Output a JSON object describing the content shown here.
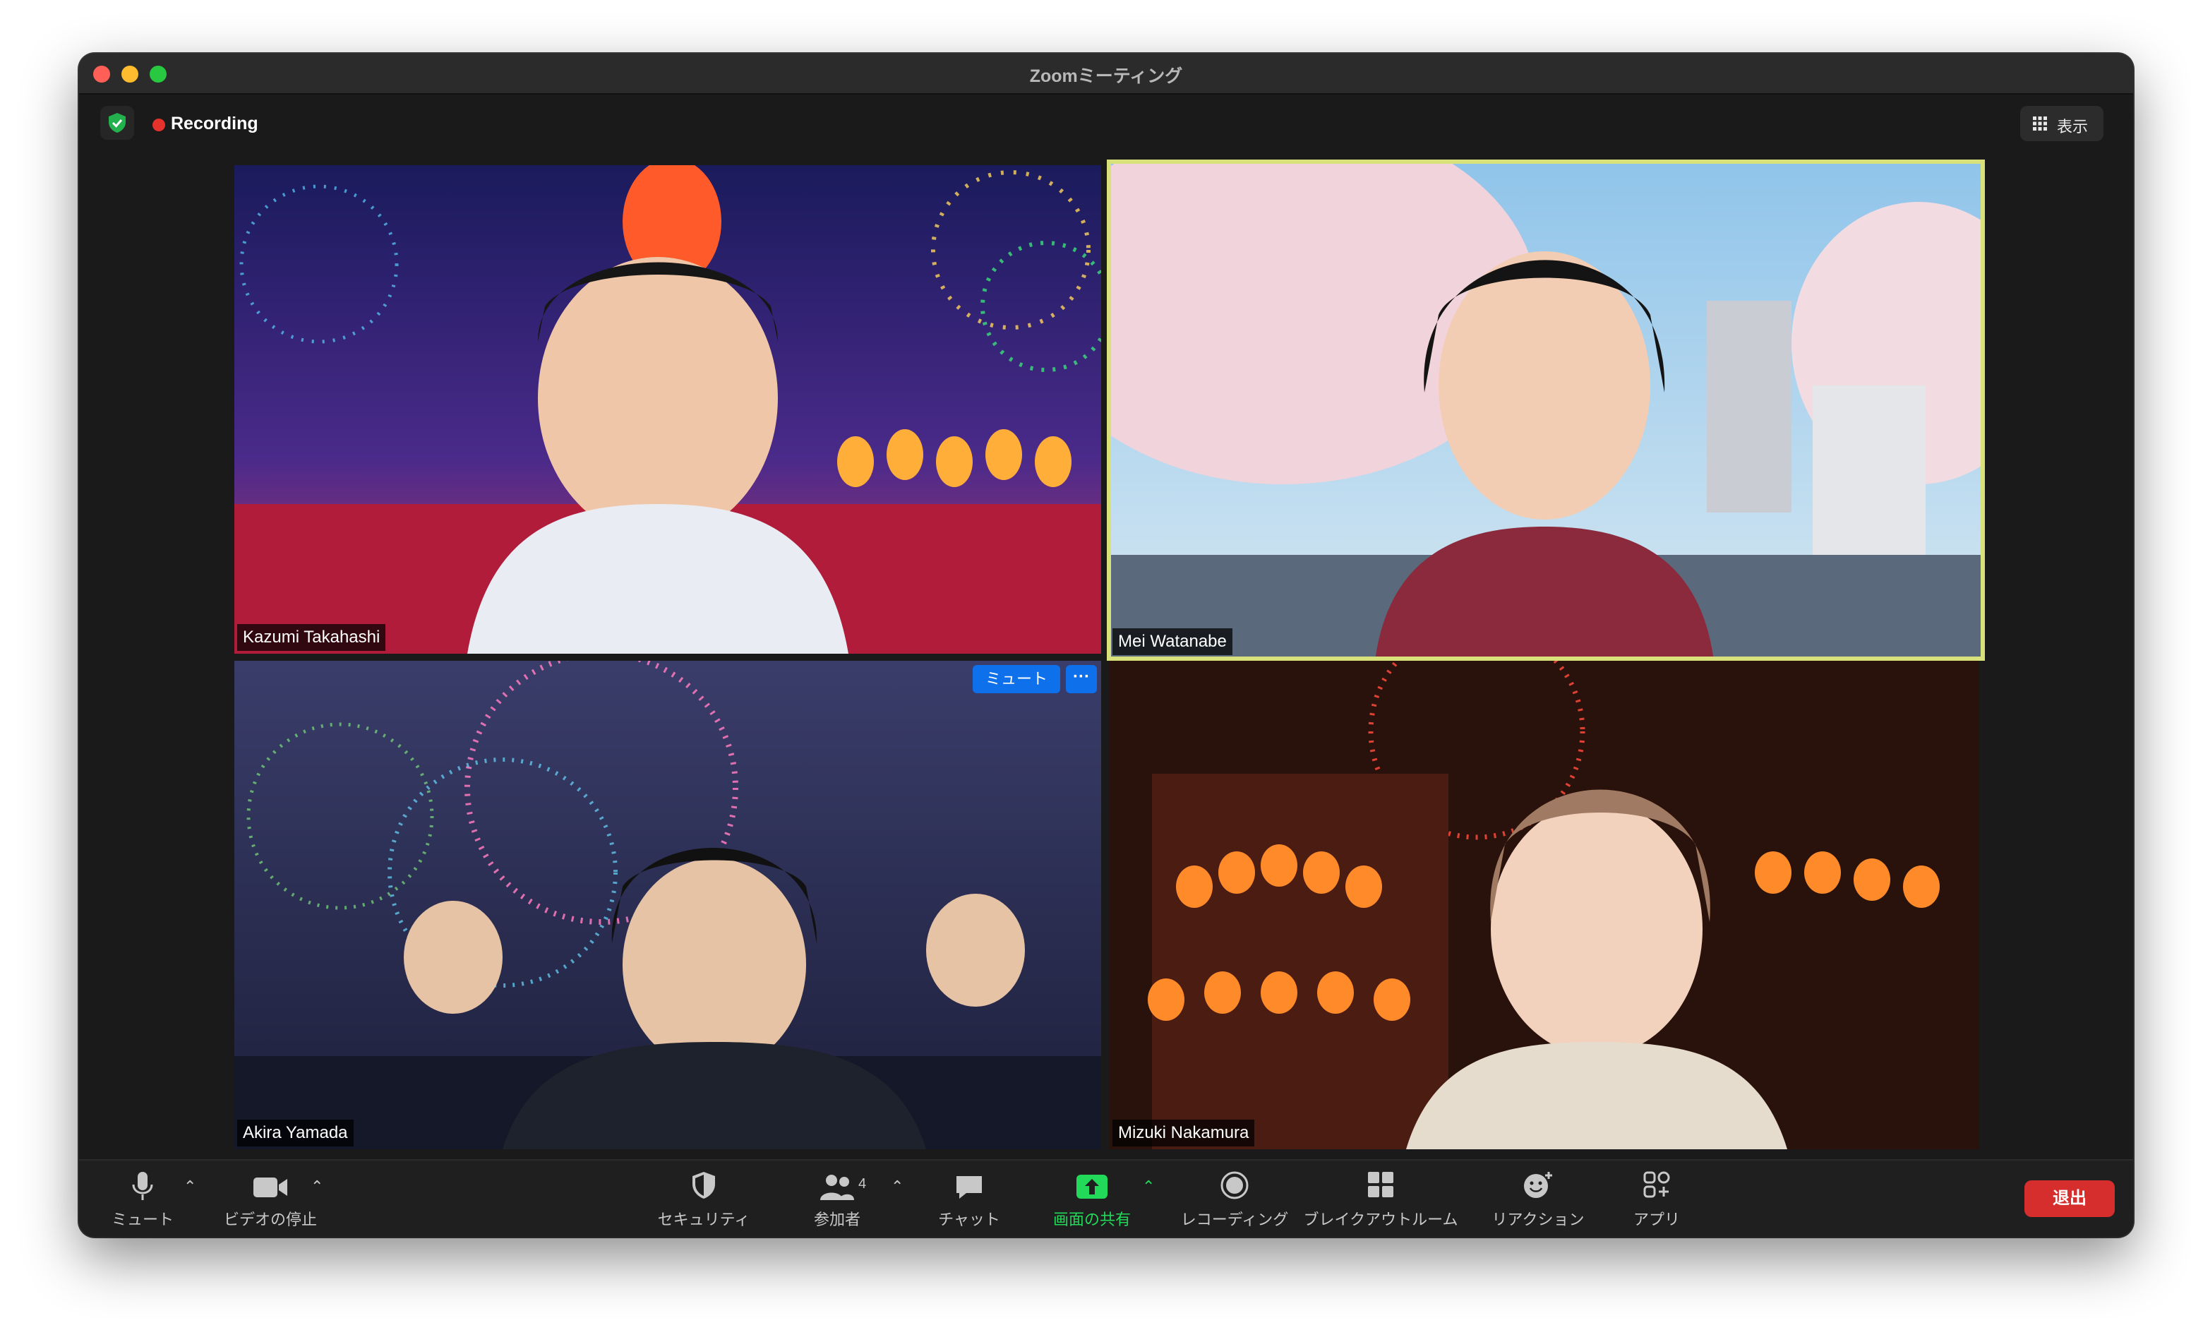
{
  "window": {
    "title": "Zoomミーティング"
  },
  "topbar": {
    "recording_label": "Recording",
    "view_label": "表示"
  },
  "participants": [
    {
      "name": "Kazumi Takahashi"
    },
    {
      "name": "Mei Watanabe"
    },
    {
      "name": "Akira Yamada",
      "mute_label": "ミュート",
      "more_label": "···"
    },
    {
      "name": "Mizuki Nakamura"
    }
  ],
  "toolbar": {
    "mute": "ミュート",
    "video": "ビデオの停止",
    "security": "セキュリティ",
    "participants": "参加者",
    "participant_count": "4",
    "chat": "チャット",
    "share": "画面の共有",
    "record": "レコーディング",
    "breakout": "ブレイクアウトルーム",
    "reactions": "リアクション",
    "apps": "アプリ",
    "leave": "退出"
  },
  "colors": {
    "active_speaker_border": "#d9e27a",
    "recording": "#e5322d",
    "share": "#23d959",
    "leave": "#d62d2d",
    "mute_pill": "#0e71eb"
  }
}
